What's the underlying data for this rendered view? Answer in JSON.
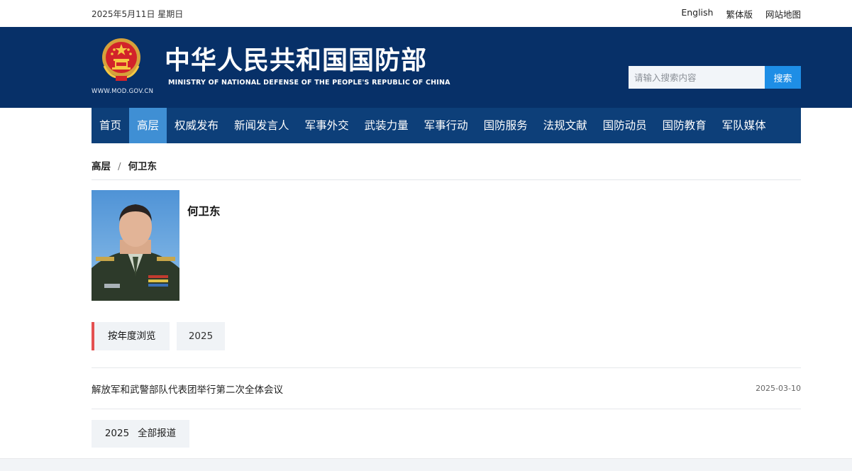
{
  "topbar": {
    "date": "2025年5月11日 星期日",
    "links": [
      "English",
      "繁体版",
      "网站地图"
    ]
  },
  "header": {
    "title_cn": "中华人民共和国国防部",
    "title_en": "MINISTRY OF NATIONAL DEFENSE OF THE PEOPLE'S REPUBLIC OF CHINA",
    "site_url": "WWW.MOD.GOV.CN",
    "search_placeholder": "请输入搜索内容",
    "search_button": "搜索"
  },
  "nav": {
    "items": [
      "首页",
      "高层",
      "权威发布",
      "新闻发言人",
      "军事外交",
      "武装力量",
      "军事行动",
      "国防服务",
      "法规文献",
      "国防动员",
      "国防教育",
      "军队媒体"
    ],
    "active": "高层"
  },
  "breadcrumb": {
    "parent": "高层",
    "sep": "/",
    "current": "何卫东"
  },
  "profile": {
    "name": "何卫东"
  },
  "browse": {
    "label": "按年度浏览",
    "year": "2025"
  },
  "news": [
    {
      "title": "解放军和武警部队代表团举行第二次全体会议",
      "date": "2025-03-10"
    }
  ],
  "all_reports": {
    "year": "2025",
    "label": "全部报道"
  },
  "colors": {
    "header_bg": "#073068",
    "nav_bg": "#0d3f79",
    "nav_active": "#3f8fd4",
    "search_button": "#1e8ee6",
    "accent_red": "#e45050"
  }
}
